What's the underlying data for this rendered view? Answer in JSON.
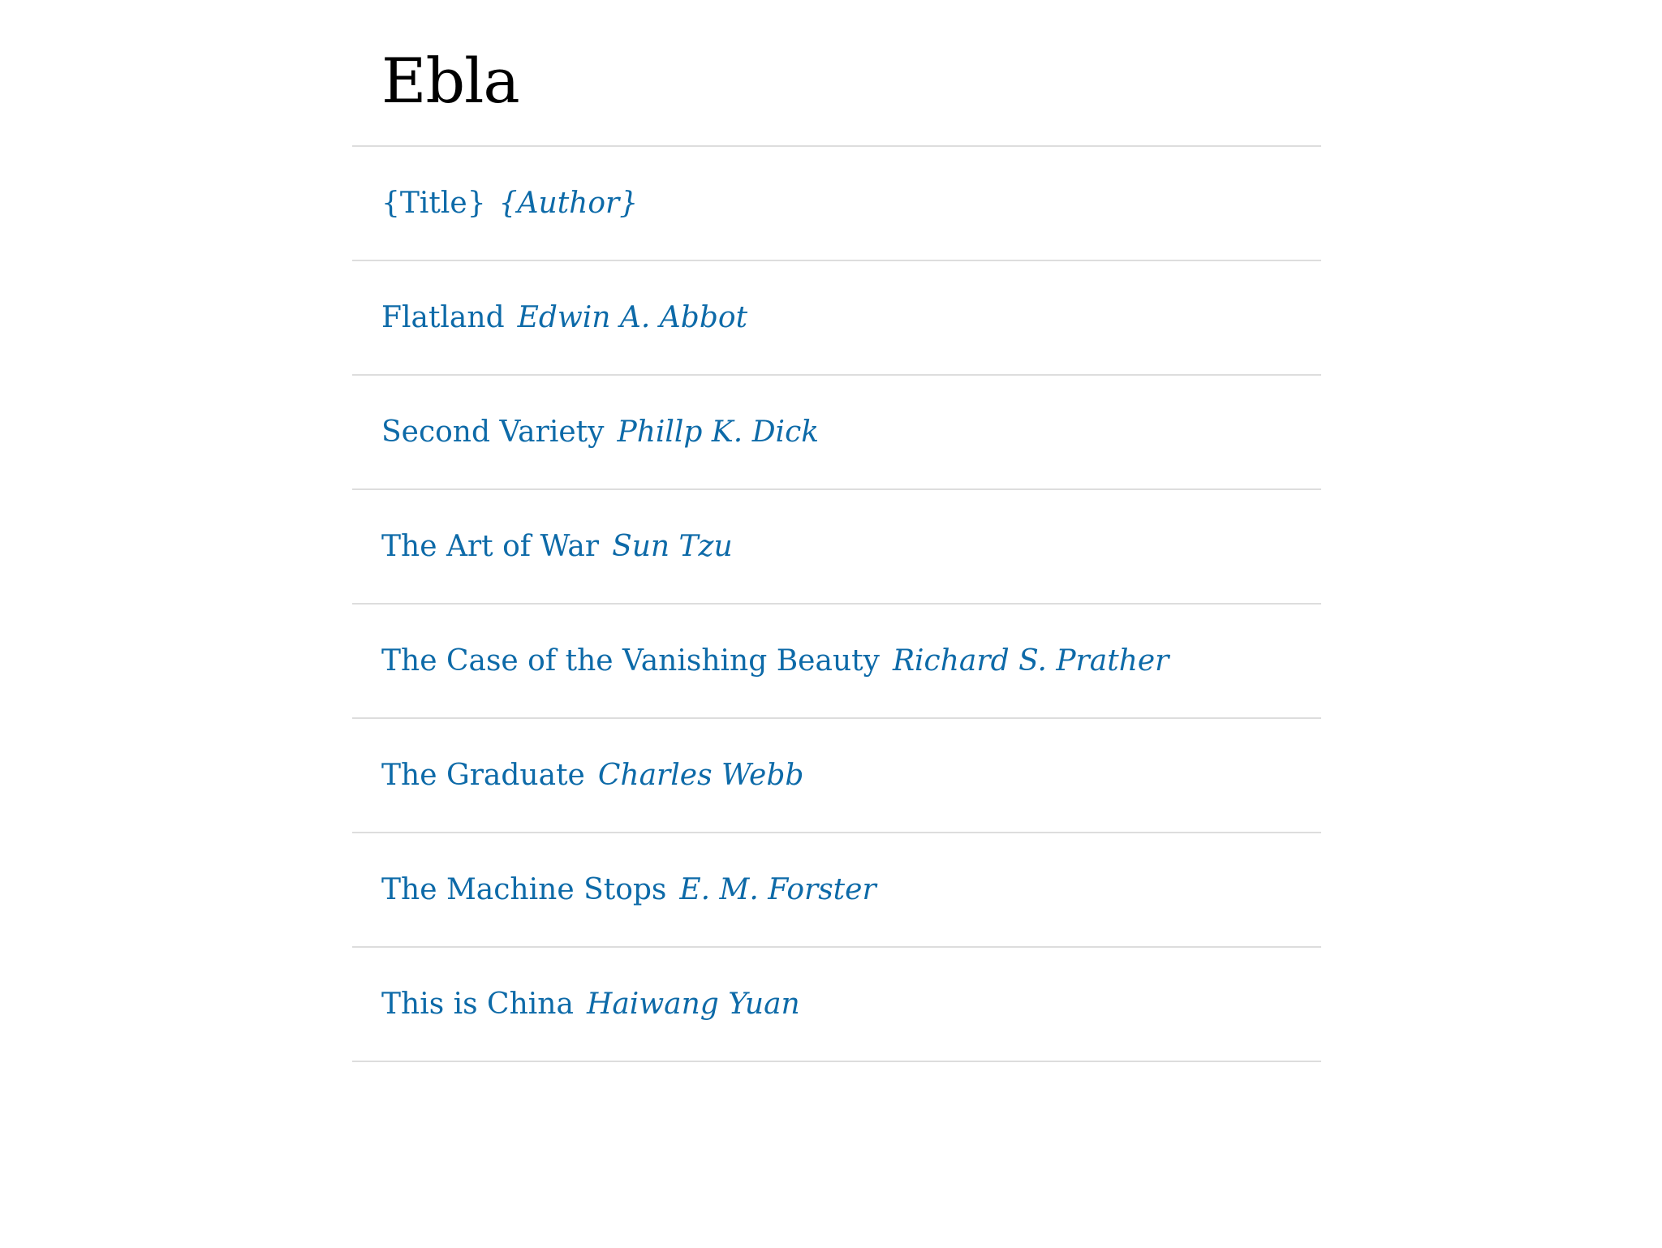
{
  "page": {
    "title": "Ebla"
  },
  "colors": {
    "link": "#0d6aa8",
    "divider": "#dddddd",
    "title": "#000000"
  },
  "books": [
    {
      "title": "{Title}",
      "author": "{Author}"
    },
    {
      "title": "Flatland",
      "author": "Edwin A. Abbot"
    },
    {
      "title": "Second Variety",
      "author": "Phillp K. Dick"
    },
    {
      "title": "The Art of War",
      "author": "Sun Tzu"
    },
    {
      "title": "The Case of the Vanishing Beauty",
      "author": "Richard S. Prather"
    },
    {
      "title": "The Graduate",
      "author": "Charles Webb"
    },
    {
      "title": "The Machine Stops",
      "author": "E. M. Forster"
    },
    {
      "title": "This is China",
      "author": "Haiwang Yuan"
    }
  ]
}
